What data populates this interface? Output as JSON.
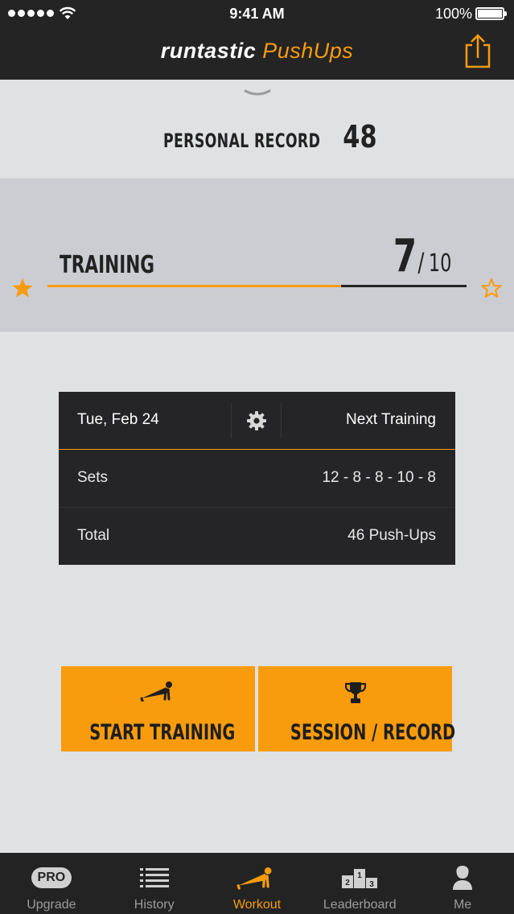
{
  "status_bar": {
    "time": "9:41 AM",
    "battery": "100%"
  },
  "header": {
    "brand_primary": "runtastic",
    "brand_secondary": "PushUps",
    "share_icon": "share-icon"
  },
  "personal_record": {
    "label": "PERSONAL RECORD",
    "value": "48"
  },
  "training": {
    "title": "TRAINING",
    "current": "7",
    "separator": "/",
    "total": "10",
    "progress_fraction": 0.7
  },
  "next_training": {
    "date": "Tue, Feb 24",
    "settings_icon": "gear-icon",
    "label": "Next Training",
    "rows": [
      {
        "label": "Sets",
        "value": "12 - 8 - 8 - 10 - 8"
      },
      {
        "label": "Total",
        "value": "46 Push-Ups"
      }
    ]
  },
  "actions": {
    "start_label": "START TRAINING",
    "start_icon": "pushup-icon",
    "session_label": "SESSION / RECORD",
    "session_icon": "trophy-icon"
  },
  "tabs": [
    {
      "label": "Upgrade",
      "icon": "pro-badge",
      "badge": "PRO"
    },
    {
      "label": "History",
      "icon": "list-icon"
    },
    {
      "label": "Workout",
      "icon": "pushup-icon",
      "active": true
    },
    {
      "label": "Leaderboard",
      "icon": "podium-icon"
    },
    {
      "label": "Me",
      "icon": "person-icon"
    }
  ],
  "colors": {
    "accent": "#f89c0e",
    "dark": "#242424",
    "background": "#e0e1e3"
  }
}
